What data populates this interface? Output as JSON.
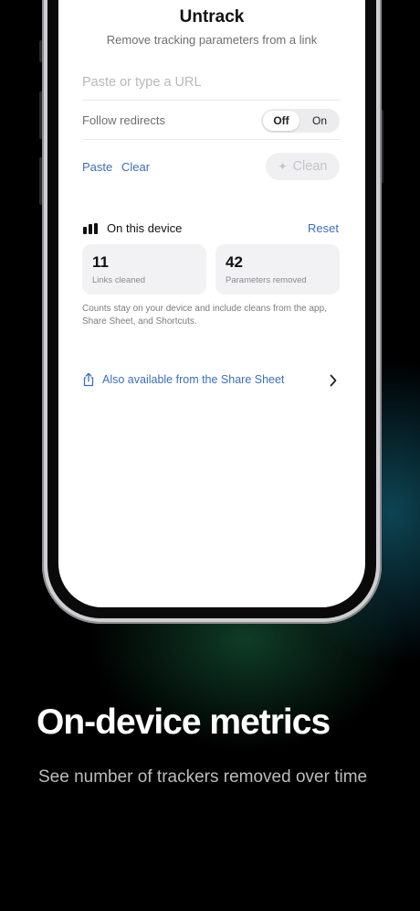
{
  "app": {
    "title": "Untrack",
    "subtitle": "Remove tracking parameters from a link"
  },
  "url_input": {
    "placeholder": "Paste or type a URL",
    "value": ""
  },
  "follow_redirects": {
    "label": "Follow redirects",
    "options": [
      "Off",
      "On"
    ],
    "selected": "Off"
  },
  "actions": {
    "paste": "Paste",
    "clear": "Clear",
    "clean": "Clean",
    "clean_icon": "sparkle-icon"
  },
  "metrics": {
    "heading": "On this device",
    "heading_icon": "bar-chart-icon",
    "reset": "Reset",
    "cards": [
      {
        "value": "11",
        "label": "Links cleaned"
      },
      {
        "value": "42",
        "label": "Parameters removed"
      }
    ],
    "note": "Counts stay on your device and include cleans from the app, Share Sheet, and Shortcuts."
  },
  "share_sheet": {
    "label": "Also available from the Share Sheet",
    "icon": "share-icon",
    "chevron": "chevron-right-icon"
  },
  "promo": {
    "headline": "On-device metrics",
    "tagline": "See number of trackers removed over time"
  },
  "colors": {
    "accent": "#3b6fbf",
    "background": "#000000",
    "screen": "#ffffff"
  }
}
